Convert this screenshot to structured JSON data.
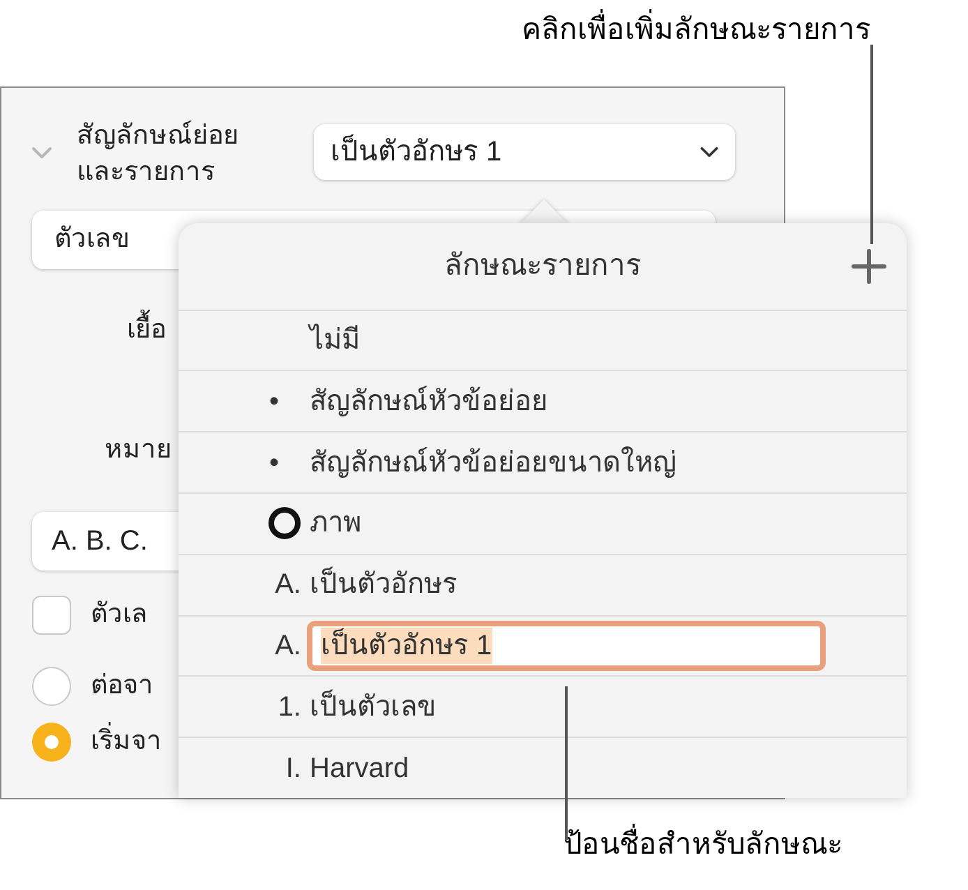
{
  "callouts": [
    {
      "text": "คลิกเพื่อเพิ่มลักษณะรายการ"
    },
    {
      "text": "ป้อนชื่อสำหรับลักษณะ"
    }
  ],
  "panel": {
    "section": {
      "label_lines": [
        "สัญลักษณ์ย่อย",
        "และรายการ"
      ],
      "expanded": true,
      "style_value": "เป็นตัวอักษร 1"
    },
    "type_field": "ตัวเลข",
    "indent_label": "เยื้อ",
    "marker_label": "หมาย",
    "format_field": "A. B. C.",
    "checkbox": {
      "label": "ตัวเล",
      "checked": false
    },
    "radios": [
      {
        "label": "ต่อจา",
        "selected": false
      },
      {
        "label": "เริ่มจา",
        "selected": true
      }
    ]
  },
  "popover": {
    "title": "ลักษณะรายการ",
    "items": [
      {
        "kind": "none",
        "label": "ไม่มี"
      },
      {
        "kind": "bullet",
        "marker": "•",
        "label": "สัญลักษณ์หัวข้อย่อย"
      },
      {
        "kind": "bullet",
        "marker": "•",
        "label": "สัญลักษณ์หัวข้อย่อยขนาดใหญ่"
      },
      {
        "kind": "image",
        "label": "ภาพ"
      },
      {
        "kind": "text",
        "marker": "A.",
        "label": "เป็นตัวอักษร"
      },
      {
        "kind": "editing",
        "marker": "A.",
        "label": "เป็นตัวอักษร 1"
      },
      {
        "kind": "text",
        "marker": "1.",
        "label": "เป็นตัวเลข"
      },
      {
        "kind": "text",
        "marker": "I.",
        "label": "Harvard"
      }
    ]
  }
}
